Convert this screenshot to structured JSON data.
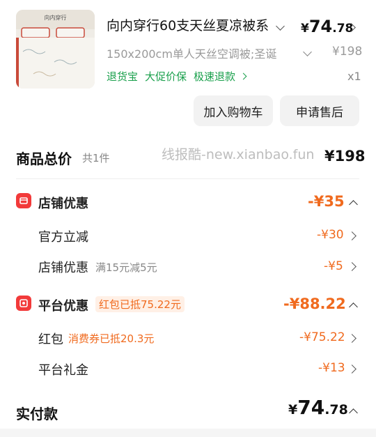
{
  "product": {
    "image_text": "向内穿行",
    "title": "向内穿行60支天丝夏凉被系",
    "spec": "150x200cm单人天丝空调被;圣诞",
    "price_symbol": "¥",
    "price_int": "74",
    "price_dec": ".78",
    "original_price": "¥198",
    "tags": [
      "退货宝",
      "大促价保",
      "极速退款"
    ],
    "quantity": "x1"
  },
  "actions": {
    "add_cart": "加入购物车",
    "after_sale": "申请售后"
  },
  "total": {
    "label": "商品总价",
    "count": "共1件",
    "value": "¥198"
  },
  "watermark": "线报酷-new.xianbao.fun",
  "shop_discount": {
    "label": "店铺优惠",
    "value": "-¥35",
    "items": [
      {
        "label": "官方立减",
        "note": "",
        "value": "-¥30"
      },
      {
        "label": "店铺优惠",
        "note": "满15元减5元",
        "value": "-¥5"
      }
    ]
  },
  "platform_discount": {
    "label": "平台优惠",
    "badge": "红包已抵75.22元",
    "value": "-¥88.22",
    "items": [
      {
        "label": "红包",
        "note": "消费券已抵20.3元",
        "value": "-¥75.22"
      },
      {
        "label": "平台礼金",
        "note": "",
        "value": "-¥13"
      }
    ]
  },
  "paid": {
    "label": "实付款",
    "symbol": "¥",
    "int": "74",
    "dec": ".78"
  },
  "colors": {
    "accent": "#f06a1e",
    "green": "#1aa04c",
    "red_icon": "#f23a3a"
  }
}
